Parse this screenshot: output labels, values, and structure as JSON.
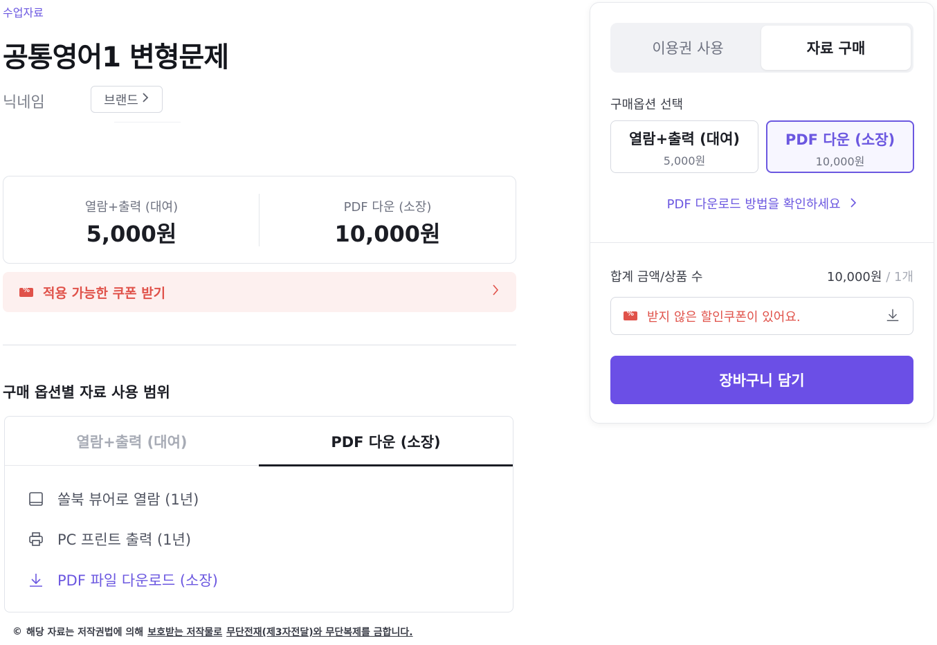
{
  "header": {
    "category": "수업자료",
    "title": "공통영어1 변형문제",
    "nickname": "닉네임",
    "brand_button": "브랜드"
  },
  "prices": {
    "rental_label": "열람+출력 (대여)",
    "rental_value": "5,000원",
    "pdf_label": "PDF 다운 (소장)",
    "pdf_value": "10,000원"
  },
  "coupon_banner": {
    "text": "적용 가능한 쿠폰 받기"
  },
  "scope": {
    "title": "구매 옵션별 자료 사용 범위",
    "tabs": [
      {
        "label": "열람+출력 (대여)",
        "active": false
      },
      {
        "label": "PDF 다운 (소장)",
        "active": true
      }
    ],
    "features": [
      {
        "icon": "book-icon",
        "label": "쏠북 뷰어로 열람 (1년)"
      },
      {
        "icon": "printer-icon",
        "label": "PC 프린트 출력 (1년)"
      },
      {
        "icon": "download-icon",
        "label": "PDF 파일 다운로드 (소장)"
      }
    ]
  },
  "copyright": {
    "symbol": "©",
    "text_plain": "해당 자료는 저작권법에 의해",
    "text_underlined_1": "보호받는 저작물로",
    "text_underlined_2": "무단전재(제3자전달)와 무단복제를 금합니다."
  },
  "panel": {
    "tabs": [
      {
        "label": "이용권 사용",
        "active": false
      },
      {
        "label": "자료 구매",
        "active": true
      }
    ],
    "option_label": "구매옵션 선택",
    "options": [
      {
        "name": "열람+출력 (대여)",
        "price": "5,000원",
        "selected": false
      },
      {
        "name": "PDF 다운 (소장)",
        "price": "10,000원",
        "selected": true
      }
    ],
    "pdf_help_link": "PDF 다운로드 방법을 확인하세요",
    "summary_label": "합계 금액/상품 수",
    "summary_amount": "10,000원",
    "summary_count": "/ 1개",
    "coupon_notice": "받지 않은 할인쿠폰이 있어요.",
    "cart_button": "장바구니 담기"
  },
  "colors": {
    "accent": "#6b57e0",
    "button": "#6b4fe6",
    "coupon_red": "#e0524a",
    "coupon_bg": "#fdf0ef"
  }
}
